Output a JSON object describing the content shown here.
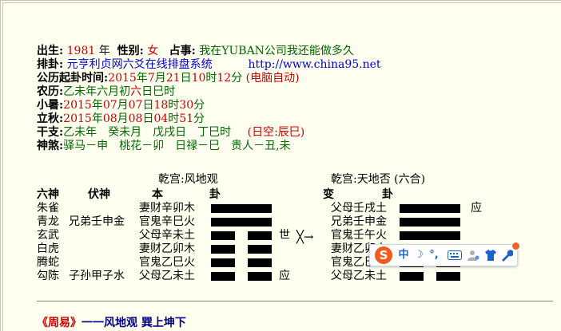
{
  "info": {
    "birth_label": "出生:",
    "birth_year": "1981",
    "year_unit": "年",
    "gender_label": "性别:",
    "gender": "女",
    "matter_label": "占事:",
    "matter": "我在YUBAN公司我还能做多久",
    "paigua_label": "排卦:",
    "paigua": "元亨利贞网六爻在线排盘系统",
    "url": "http://www.china95.net",
    "time_label": "公历起卦时间:",
    "time_year": "2015",
    "time_month": "7",
    "time_day": "21",
    "time_hour": "10",
    "time_min": "12",
    "time_note": "(电脑自动)",
    "lunar_label": "农历:",
    "lunar_a": "乙未年六月初",
    "lunar_b": "六",
    "lunar_c": "日巳时",
    "xiaoshu_label": "小暑:",
    "xiaoshu_y": "2015",
    "xiaoshu_m": "07",
    "xiaoshu_d": "07",
    "xiaoshu_h": "18",
    "xiaoshu_min": "30",
    "liqiu_label": "立秋:",
    "liqiu_y": "2015",
    "liqiu_m": "08",
    "liqiu_d": "08",
    "liqiu_h": "04",
    "liqiu_min": "51",
    "ganzhi_label": "干支:",
    "ganzhi": "乙未年　癸未月　戊戌日　丁巳时",
    "kong": "(日空:辰巳)",
    "shensha_label": "神煞:",
    "shensha": "驿马－申　桃花－卯　日禄－巳　贵人－丑,未"
  },
  "units": {
    "nian": "年",
    "yue": "月",
    "ri": "日",
    "shi": "时",
    "fen": "分"
  },
  "gua": {
    "main_title": "乾宫:风地观",
    "changed_title": "乾宫:天地否 (六合)",
    "col_liushen": "六神",
    "col_fushen": "伏神",
    "col_ben": "本",
    "col_gua": "卦",
    "col_bian": "变",
    "col_gua2": "卦",
    "rows": [
      {
        "liushen": "朱雀",
        "fushen": "",
        "ben": "妻财辛卯木",
        "yang": true,
        "mark": "",
        "bian": "父母壬戌土",
        "byang": true,
        "bmark": "应"
      },
      {
        "liushen": "青龙",
        "fushen": "兄弟壬申金",
        "ben": "官鬼辛巳火",
        "yang": true,
        "mark": "",
        "bian": "兄弟壬申金",
        "byang": true,
        "bmark": ""
      },
      {
        "liushen": "玄武",
        "fushen": "",
        "ben": "父母辛未土",
        "yang": false,
        "mark": "世",
        "bian": "官鬼壬午火",
        "byang": true,
        "bmark": ""
      },
      {
        "liushen": "白虎",
        "fushen": "",
        "ben": "妻财乙卯木",
        "yang": false,
        "mark": "",
        "bian": "妻财乙卯木",
        "byang": false,
        "bmark": ""
      },
      {
        "liushen": "腾蛇",
        "fushen": "",
        "ben": "官鬼乙巳火",
        "yang": false,
        "mark": "",
        "bian": "官鬼乙巳火",
        "byang": false,
        "bmark": ""
      },
      {
        "liushen": "勾陈",
        "fushen": "子孙甲子水",
        "ben": "父母乙未土",
        "yang": false,
        "mark": "应",
        "bian": "父母乙未土",
        "byang": false,
        "bmark": ""
      }
    ],
    "change_arrow": "╳→"
  },
  "zhouyi": {
    "title": "《周易》",
    "text": "一一风地观 巽上坤下"
  },
  "toolbar": {
    "logo": "S",
    "zh": "中",
    "moon": "☽",
    "punct": "°,",
    "keyboard_icon": "keyboard-icon",
    "user_icon": "user-icon",
    "skin_icon": "shirt-icon",
    "tool_icon": "wrench-icon"
  }
}
